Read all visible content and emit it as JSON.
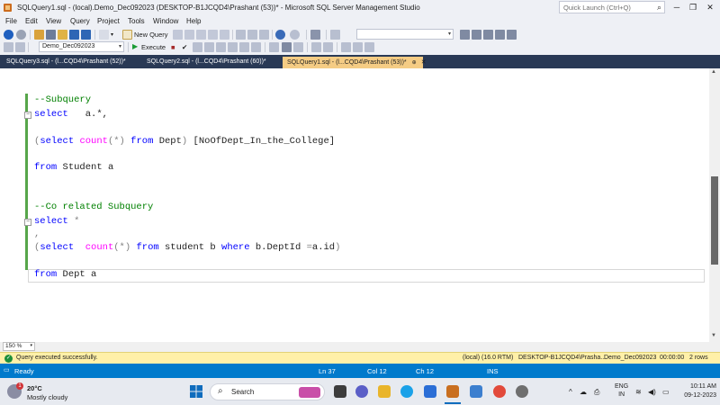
{
  "window": {
    "title": "SQLQuery1.sql - (local).Demo_Dec092023 (DESKTOP-B1JCQD4\\Prashant (53))* - Microsoft SQL Server Management Studio",
    "quick_launch_placeholder": "Quick Launch (Ctrl+Q)"
  },
  "menu": [
    "File",
    "Edit",
    "View",
    "Query",
    "Project",
    "Tools",
    "Window",
    "Help"
  ],
  "toolbar": {
    "new_query_label": "New Query",
    "database_combo": "Demo_Dec092023",
    "execute_label": "Execute"
  },
  "tabs": [
    {
      "label": "SQLQuery3.sql - (l...CQD4\\Prashant (52))*",
      "active": false
    },
    {
      "label": "SQLQuery2.sql - (l...CQD4\\Prashant (60))*",
      "active": false
    },
    {
      "label": "SQLQuery1.sql - (l...CQD4\\Prashant (53))*",
      "active": true
    }
  ],
  "editor": {
    "lines": {
      "c1": "--Subquery",
      "l2_kw": "select",
      "l2_rest": "   a.*,",
      "l3_p1": "(",
      "l3_kw1": "select",
      "l3_fn": "count",
      "l3_p2": "(*)",
      "l3_kw2": "from",
      "l3_rest": "Dept",
      "l3_p3": ")",
      "l3_alias": "[NoOfDept_In_the_College]",
      "l4_kw": "from",
      "l4_rest": "Student a",
      "c2": "--Co related Subquery",
      "l5_kw": "select",
      "l5_star": "*",
      "l6": ",",
      "l7_p1": "(",
      "l7_kw1": "select",
      "l7_fn": "count",
      "l7_p2": "(*)",
      "l7_kw2": "from",
      "l7_t1": "student b",
      "l7_kw3": "where",
      "l7_t2": "b.DeptId",
      "l7_op": "=",
      "l7_t3": "a.id",
      "l7_p3": ")",
      "l8_kw": "from",
      "l8_rest": "Dept a"
    }
  },
  "zoom": "150 %",
  "query_status": {
    "message": "Query executed successfully.",
    "server": "(local) (16.0 RTM)",
    "user": "DESKTOP-B1JCQD4\\Prasha...",
    "database": "Demo_Dec092023",
    "elapsed": "00:00:00",
    "rows": "2 rows"
  },
  "statusbar": {
    "state": "Ready",
    "ln": "Ln 37",
    "col": "Col 12",
    "ch": "Ch 12",
    "ins": "INS"
  },
  "taskbar": {
    "weather_temp": "20°C",
    "weather_cond": "Mostly cloudy",
    "weather_alert": "1",
    "search_label": "Search",
    "lang_line1": "ENG",
    "lang_line2": "IN",
    "time": "10:11 AM",
    "date": "09-12-2023"
  },
  "colors": {
    "keyword": "#0000ff",
    "comment": "#008000",
    "function": "#ff00ff",
    "operator": "#808080",
    "statusbar": "#007acc",
    "active_tab": "#f5cc84",
    "query_status_bg": "#fff0a8"
  }
}
